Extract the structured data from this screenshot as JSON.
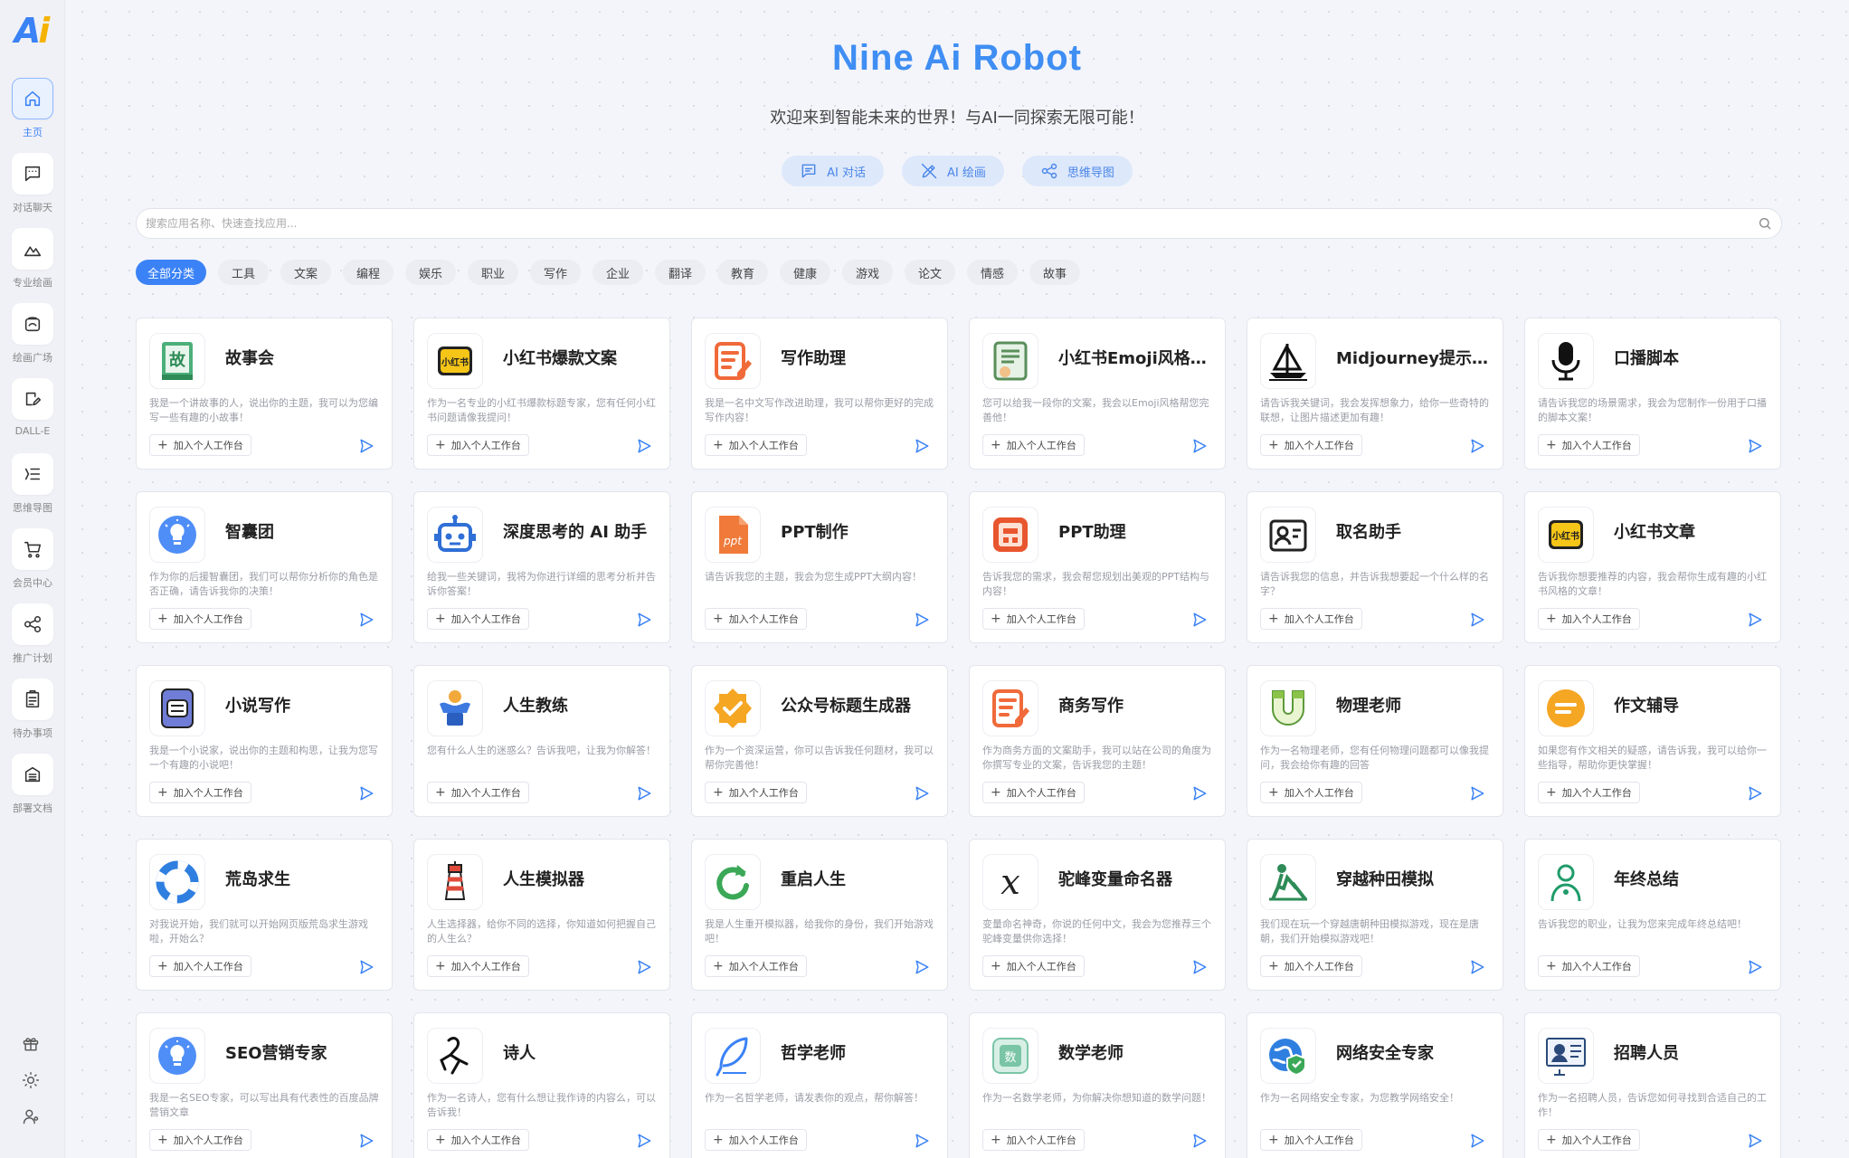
{
  "brand": {
    "logo_text": "Ai"
  },
  "sidebar": {
    "items": [
      {
        "label": "主页",
        "icon": "home-icon",
        "active": true
      },
      {
        "label": "对话聊天",
        "icon": "chat-icon"
      },
      {
        "label": "专业绘画",
        "icon": "mountain-icon"
      },
      {
        "label": "绘画广场",
        "icon": "gallery-icon"
      },
      {
        "label": "DALL-E",
        "icon": "draw-icon"
      },
      {
        "label": "思维导图",
        "icon": "mindmap-icon"
      },
      {
        "label": "会员中心",
        "icon": "cart-icon"
      },
      {
        "label": "推广计划",
        "icon": "share-icon"
      },
      {
        "label": "待办事项",
        "icon": "clipboard-icon"
      },
      {
        "label": "部署文档",
        "icon": "docs-icon"
      }
    ],
    "bottom": [
      "gift-icon",
      "theme-sun-icon",
      "user-settings-icon"
    ]
  },
  "hero": {
    "title": "Nine Ai Robot",
    "subtitle": "欢迎来到智能未来的世界！与AI一同探索无限可能！",
    "quick_actions": [
      {
        "label": "AI 对话",
        "icon": "chat-icon"
      },
      {
        "label": "AI 绘画",
        "icon": "brush-icon"
      },
      {
        "label": "思维导图",
        "icon": "mindmap-icon"
      }
    ]
  },
  "search": {
    "placeholder": "搜索应用名称、快速查找应用...",
    "value": ""
  },
  "categories": [
    "全部分类",
    "工具",
    "文案",
    "编程",
    "娱乐",
    "职业",
    "写作",
    "企业",
    "翻译",
    "教育",
    "健康",
    "游戏",
    "论文",
    "情感",
    "故事"
  ],
  "active_category": "全部分类",
  "add_label": "加入个人工作台",
  "cards": [
    {
      "title": "故事会",
      "desc": "我是一个讲故事的人，说出你的主题，我可以为您编写一些有趣的小故事！",
      "icon": "book-icon"
    },
    {
      "title": "小红书爆款文案",
      "desc": "作为一名专业的小红书爆款标题专家，您有任何小红书问题请像我提问！",
      "icon": "xiaohongshu-icon"
    },
    {
      "title": "写作助理",
      "desc": "我是一名中文写作改进助理，我可以帮你更好的完成写作内容！",
      "icon": "edit-note-icon"
    },
    {
      "title": "小红书Emoji风格文案",
      "desc": "您可以给我一段你的文案，我会以Emoji风格帮您完善他！",
      "icon": "notebook-icon"
    },
    {
      "title": "Midjourney提示词生成",
      "desc": "请告诉我关键词，我会发挥想象力，给你一些奇特的联想，让图片描述更加有趣！",
      "icon": "sailboat-icon"
    },
    {
      "title": "口播脚本",
      "desc": "请告诉我您的场景需求，我会为您制作一份用于口播的脚本文案！",
      "icon": "microphone-icon"
    },
    {
      "title": "智囊团",
      "desc": "作为你的后援智囊团，我们可以帮你分析你的角色是否正确，请告诉我你的决策！",
      "icon": "lightbulb-icon"
    },
    {
      "title": "深度思考的 AI 助手",
      "desc": "给我一些关键词，我将为你进行详细的思考分析并告诉你答案！",
      "icon": "robot-icon"
    },
    {
      "title": "PPT制作",
      "desc": "请告诉我您的主题，我会为您生成PPT大纲内容！",
      "icon": "ppt-icon"
    },
    {
      "title": "PPT助理",
      "desc": "告诉我您的需求，我会帮您规划出美观的PPT结构与内容！",
      "icon": "ppt-assist-icon"
    },
    {
      "title": "取名助手",
      "desc": "请告诉我您的信息，并告诉我想要起一个什么样的名字？",
      "icon": "name-card-icon"
    },
    {
      "title": "小红书文章",
      "desc": "告诉我你想要推荐的内容，我会帮你生成有趣的小红书风格的文章！",
      "icon": "xiaohongshu-icon"
    },
    {
      "title": "小说写作",
      "desc": "我是一个小说家，说出你的主题和构思，让我为您写一个有趣的小说吧！",
      "icon": "novel-icon"
    },
    {
      "title": "人生教练",
      "desc": "您有什么人生的迷惑么？告诉我吧，让我为你解答！",
      "icon": "strongman-icon"
    },
    {
      "title": "公众号标题生成器",
      "desc": "作为一个资深运营，你可以告诉我任何题材，我可以帮你完善他！",
      "icon": "badge-check-icon"
    },
    {
      "title": "商务写作",
      "desc": "作为商务方面的文案助手，我可以站在公司的角度为你撰写专业的文案，告诉我您的主题！",
      "icon": "edit-note-icon"
    },
    {
      "title": "物理老师",
      "desc": "作为一名物理老师，您有任何物理问题都可以像我提问，我会给你有趣的回答",
      "icon": "magnet-icon"
    },
    {
      "title": "作文辅导",
      "desc": "如果您有作文相关的疑惑，请告诉我，我可以给你一些指导，帮助你更快掌握！",
      "icon": "essay-icon"
    },
    {
      "title": "荒岛求生",
      "desc": "对我说开始，我们就可以开始网页版荒岛求生游戏啦，开始么？",
      "icon": "lifebuoy-icon"
    },
    {
      "title": "人生模拟器",
      "desc": "人生选择器，给你不同的选择，你知道如何把握自己的人生么？",
      "icon": "lighthouse-icon"
    },
    {
      "title": "重启人生",
      "desc": "我是人生重开模拟器，给我你的身份，我们开始游戏吧！",
      "icon": "restart-icon"
    },
    {
      "title": "驼峰变量命名器",
      "desc": "变量命名神奇，你说的任何中文，我会为您推荐三个驼峰变量供你选择！",
      "icon": "variable-icon"
    },
    {
      "title": "穿越种田模拟",
      "desc": "我们现在玩一个穿越唐朝种田模拟游戏，现在是唐朝，我们开始模拟游戏吧！",
      "icon": "farmer-icon"
    },
    {
      "title": "年终总结",
      "desc": "告诉我您的职业，让我为您来完成年终总结吧！",
      "icon": "person-icon"
    },
    {
      "title": "SEO营销专家",
      "desc": "我是一名SEO专家，可以写出具有代表性的百度品牌营销文章",
      "icon": "lightbulb-icon"
    },
    {
      "title": "诗人",
      "desc": "作为一名诗人，您有什么想让我作诗的内容么，可以告诉我！",
      "icon": "poet-icon"
    },
    {
      "title": "哲学老师",
      "desc": "作为一名哲学老师，请发表你的观点，帮你解答！",
      "icon": "feather-icon"
    },
    {
      "title": "数学老师",
      "desc": "作为一名数学老师，为你解决你想知道的数学问题！",
      "icon": "math-icon"
    },
    {
      "title": "网络安全专家",
      "desc": "作为一名网络安全专家，为您教学网络安全！",
      "icon": "globe-shield-icon"
    },
    {
      "title": "招聘人员",
      "desc": "作为一名招聘人员，告诉您如何寻找到合适自己的工作！",
      "icon": "recruiter-icon"
    }
  ]
}
